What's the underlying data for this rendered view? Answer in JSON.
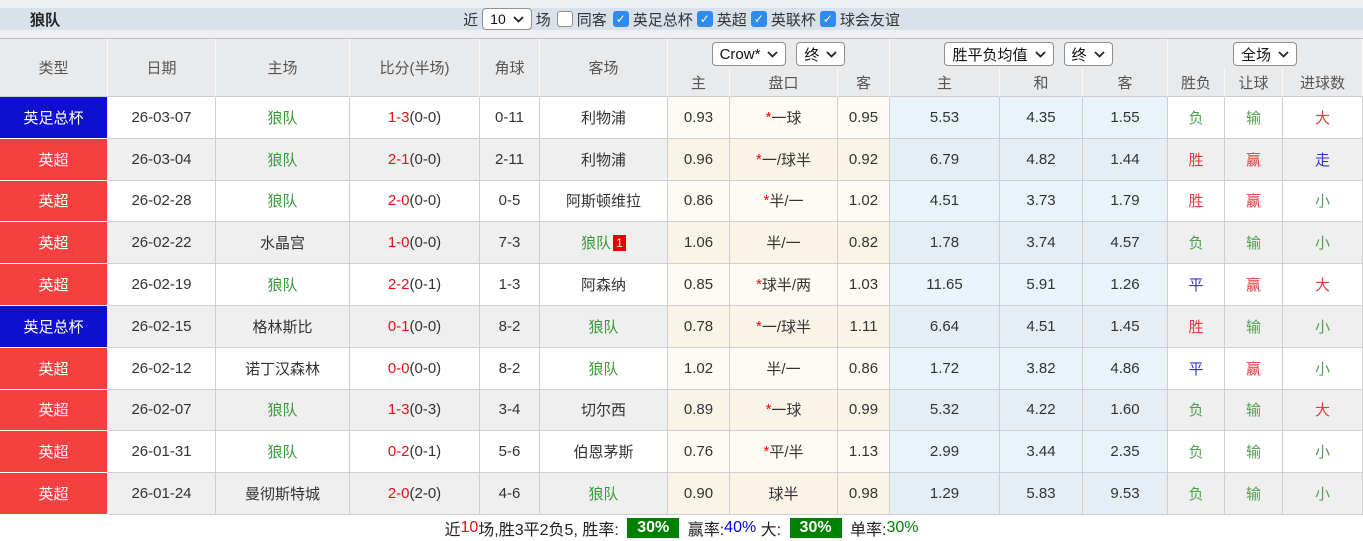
{
  "title": "狼队",
  "toolbar": {
    "recent_label": "近",
    "recent_value": "10",
    "games_label": "场",
    "checkboxes": [
      {
        "label": "同客",
        "checked": false
      },
      {
        "label": "英足总杯",
        "checked": true
      },
      {
        "label": "英超",
        "checked": true
      },
      {
        "label": "英联杯",
        "checked": true
      },
      {
        "label": "球会友谊",
        "checked": true
      }
    ]
  },
  "table": {
    "left_headers": [
      "类型",
      "日期",
      "主场",
      "比分(半场)",
      "角球",
      "客场"
    ],
    "selects": {
      "crow_company": "Crow*",
      "crow_stage": "终",
      "odds_type": "胜平负均值",
      "odds_stage": "终",
      "fulltime_scope": "全场"
    },
    "sub_headers": [
      "主",
      "盘口",
      "客",
      "主",
      "和",
      "客",
      "胜负",
      "让球",
      "进球数"
    ],
    "rows": [
      {
        "type": "英足总杯",
        "type_color": "blue",
        "date": "26-03-07",
        "home": "狼队",
        "home_team": true,
        "score": "1-3",
        "half": "(0-0)",
        "corner": "0-11",
        "away": "利物浦",
        "away_team": false,
        "away_badge": "",
        "crow_home": "0.93",
        "star": true,
        "handicap": "一球",
        "crow_away": "0.95",
        "avg_home": "5.53",
        "avg_draw": "4.35",
        "avg_away": "1.55",
        "wdl": {
          "text": "负",
          "color": "green"
        },
        "hcp": {
          "text": "输",
          "color": "green"
        },
        "goals": {
          "text": "大",
          "color": "red"
        }
      },
      {
        "type": "英超",
        "type_color": "red",
        "date": "26-03-04",
        "home": "狼队",
        "home_team": true,
        "score": "2-1",
        "half": "(0-0)",
        "corner": "2-11",
        "away": "利物浦",
        "away_team": false,
        "away_badge": "",
        "crow_home": "0.96",
        "star": true,
        "handicap": "一/球半",
        "crow_away": "0.92",
        "avg_home": "6.79",
        "avg_draw": "4.82",
        "avg_away": "1.44",
        "wdl": {
          "text": "胜",
          "color": "red"
        },
        "hcp": {
          "text": "赢",
          "color": "red"
        },
        "goals": {
          "text": "走",
          "color": "blue"
        }
      },
      {
        "type": "英超",
        "type_color": "red",
        "date": "26-02-28",
        "home": "狼队",
        "home_team": true,
        "score": "2-0",
        "half": "(0-0)",
        "corner": "0-5",
        "away": "阿斯顿维拉",
        "away_team": false,
        "away_badge": "",
        "crow_home": "0.86",
        "star": true,
        "handicap": "半/一",
        "crow_away": "1.02",
        "avg_home": "4.51",
        "avg_draw": "3.73",
        "avg_away": "1.79",
        "wdl": {
          "text": "胜",
          "color": "red"
        },
        "hcp": {
          "text": "赢",
          "color": "red"
        },
        "goals": {
          "text": "小",
          "color": "green"
        }
      },
      {
        "type": "英超",
        "type_color": "red",
        "date": "26-02-22",
        "home": "水晶宫",
        "home_team": false,
        "score": "1-0",
        "half": "(0-0)",
        "corner": "7-3",
        "away": "狼队",
        "away_team": true,
        "away_badge": "1",
        "crow_home": "1.06",
        "star": false,
        "handicap": "半/一",
        "crow_away": "0.82",
        "avg_home": "1.78",
        "avg_draw": "3.74",
        "avg_away": "4.57",
        "wdl": {
          "text": "负",
          "color": "green"
        },
        "hcp": {
          "text": "输",
          "color": "green"
        },
        "goals": {
          "text": "小",
          "color": "green"
        }
      },
      {
        "type": "英超",
        "type_color": "red",
        "date": "26-02-19",
        "home": "狼队",
        "home_team": true,
        "score": "2-2",
        "half": "(0-1)",
        "corner": "1-3",
        "away": "阿森纳",
        "away_team": false,
        "away_badge": "",
        "crow_home": "0.85",
        "star": true,
        "handicap": "球半/两",
        "crow_away": "1.03",
        "avg_home": "11.65",
        "avg_draw": "5.91",
        "avg_away": "1.26",
        "wdl": {
          "text": "平",
          "color": "blue"
        },
        "hcp": {
          "text": "赢",
          "color": "red"
        },
        "goals": {
          "text": "大",
          "color": "red"
        }
      },
      {
        "type": "英足总杯",
        "type_color": "blue",
        "date": "26-02-15",
        "home": "格林斯比",
        "home_team": false,
        "score": "0-1",
        "half": "(0-0)",
        "corner": "8-2",
        "away": "狼队",
        "away_team": true,
        "away_badge": "",
        "crow_home": "0.78",
        "star": true,
        "handicap": "一/球半",
        "crow_away": "1.11",
        "avg_home": "6.64",
        "avg_draw": "4.51",
        "avg_away": "1.45",
        "wdl": {
          "text": "胜",
          "color": "red"
        },
        "hcp": {
          "text": "输",
          "color": "green"
        },
        "goals": {
          "text": "小",
          "color": "green"
        }
      },
      {
        "type": "英超",
        "type_color": "red",
        "date": "26-02-12",
        "home": "诺丁汉森林",
        "home_team": false,
        "score": "0-0",
        "half": "(0-0)",
        "corner": "8-2",
        "away": "狼队",
        "away_team": true,
        "away_badge": "",
        "crow_home": "1.02",
        "star": false,
        "handicap": "半/一",
        "crow_away": "0.86",
        "avg_home": "1.72",
        "avg_draw": "3.82",
        "avg_away": "4.86",
        "wdl": {
          "text": "平",
          "color": "blue"
        },
        "hcp": {
          "text": "赢",
          "color": "red"
        },
        "goals": {
          "text": "小",
          "color": "green"
        }
      },
      {
        "type": "英超",
        "type_color": "red",
        "date": "26-02-07",
        "home": "狼队",
        "home_team": true,
        "score": "1-3",
        "half": "(0-3)",
        "corner": "3-4",
        "away": "切尔西",
        "away_team": false,
        "away_badge": "",
        "crow_home": "0.89",
        "star": true,
        "handicap": "一球",
        "crow_away": "0.99",
        "avg_home": "5.32",
        "avg_draw": "4.22",
        "avg_away": "1.60",
        "wdl": {
          "text": "负",
          "color": "green"
        },
        "hcp": {
          "text": "输",
          "color": "green"
        },
        "goals": {
          "text": "大",
          "color": "red"
        }
      },
      {
        "type": "英超",
        "type_color": "red",
        "date": "26-01-31",
        "home": "狼队",
        "home_team": true,
        "score": "0-2",
        "half": "(0-1)",
        "corner": "5-6",
        "away": "伯恩茅斯",
        "away_team": false,
        "away_badge": "",
        "crow_home": "0.76",
        "star": true,
        "handicap": "平/半",
        "crow_away": "1.13",
        "avg_home": "2.99",
        "avg_draw": "3.44",
        "avg_away": "2.35",
        "wdl": {
          "text": "负",
          "color": "green"
        },
        "hcp": {
          "text": "输",
          "color": "green"
        },
        "goals": {
          "text": "小",
          "color": "green"
        }
      },
      {
        "type": "英超",
        "type_color": "red",
        "date": "26-01-24",
        "home": "曼彻斯特城",
        "home_team": false,
        "score": "2-0",
        "half": "(2-0)",
        "corner": "4-6",
        "away": "狼队",
        "away_team": true,
        "away_badge": "",
        "crow_home": "0.90",
        "star": false,
        "handicap": "球半",
        "crow_away": "0.98",
        "avg_home": "1.29",
        "avg_draw": "5.83",
        "avg_away": "9.53",
        "wdl": {
          "text": "负",
          "color": "green"
        },
        "hcp": {
          "text": "输",
          "color": "green"
        },
        "goals": {
          "text": "小",
          "color": "green"
        }
      }
    ]
  },
  "footer": {
    "parts": [
      {
        "text": "近",
        "style": "plain"
      },
      {
        "text": "10",
        "style": "red"
      },
      {
        "text": "场,胜3平2负5, 胜率: ",
        "style": "plain"
      },
      {
        "text": "30%",
        "style": "badge"
      },
      {
        "text": " 赢率:",
        "style": "plain"
      },
      {
        "text": "40%",
        "style": "blue"
      },
      {
        "text": " 大: ",
        "style": "plain"
      },
      {
        "text": "30%",
        "style": "badge"
      },
      {
        "text": " 单率:",
        "style": "plain"
      },
      {
        "text": "30%",
        "style": "green"
      }
    ]
  },
  "colors": {
    "type_blue": "#0f0fd0",
    "type_red": "#f54040",
    "team_green": "#3a9a3a",
    "score_red": "#e81010",
    "result_red": "#e03e3e",
    "result_green": "#52a052",
    "result_blue": "#3333cc",
    "badge_green": "#008000",
    "rate_blue": "#0000ee",
    "checkbox_blue": "#2e8bf0",
    "topbar_bg": "#d9e1eb",
    "header_bg": "#e9eaec"
  }
}
